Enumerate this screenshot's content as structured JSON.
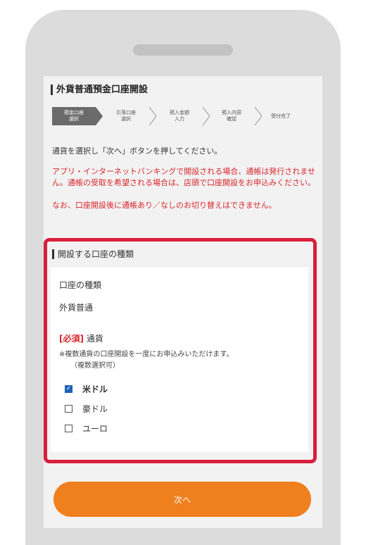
{
  "page_title": "外貨普通預金口座開設",
  "steps": [
    {
      "label": "預金口座\n選択",
      "active": true
    },
    {
      "label": "引落口座\n選択",
      "active": false
    },
    {
      "label": "預入金額\n入力",
      "active": false
    },
    {
      "label": "預入内容\n確認",
      "active": false
    },
    {
      "label": "受付完了",
      "active": false
    }
  ],
  "instruction": "通貨を選択し「次へ」ボタンを押してください。",
  "notice_1": "アプリ・インターネットバンキングで開設される場合、通帳は発行されません。通帳の受取を希望される場合は、店頭で口座開設をお申込みください。",
  "notice_2": "なお、口座開設後に通帳あり／なしのお切り替えはできません。",
  "section_heading": "開設する口座の種類",
  "account_type_label": "口座の種類",
  "account_type_value": "外貨普通",
  "currency": {
    "required_tag": "[必須]",
    "label": "通貨",
    "note_line1": "※複数通貨の口座開設を一度にお申込みいただけます。",
    "note_line2": "（複数選択可）",
    "options": [
      {
        "label": "米ドル",
        "checked": true
      },
      {
        "label": "豪ドル",
        "checked": false
      },
      {
        "label": "ユーロ",
        "checked": false
      }
    ]
  },
  "next_button": "次へ",
  "colors": {
    "accent_orange": "#f07f1d",
    "alert_red": "#d9262c",
    "highlight_red": "#d91f3d",
    "check_blue": "#1f5fb8"
  }
}
